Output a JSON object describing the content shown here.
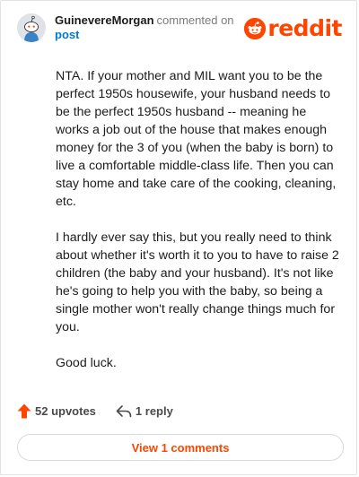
{
  "header": {
    "username": "GuinevereMorgan",
    "action_text": "commented on",
    "post_link": "post"
  },
  "brand": {
    "logo_text": "reddit",
    "logo_icon": "reddit-alien-icon",
    "accent_color": "#ff4500"
  },
  "comment": {
    "paragraphs": [
      "NTA. If your mother and MIL want you to be the perfect 1950s housewife, your husband needs to be the perfect 1950s husband -- meaning he works a job out of the house that makes enough money for the 3 of you (when the baby is born) to live a comfortable middle-class life. Then you can stay home and take care of the cooking, cleaning, etc.",
      "I hardly ever say this, but you really need to think about whether it's worth it to you to have to raise 2 children (the baby and your husband). It's not like he's going to help you with the baby, so being a single mother won't really change things much for you.",
      "Good luck."
    ]
  },
  "actions": {
    "upvotes_label": "52 upvotes",
    "upvote_icon": "upvote-arrow-icon",
    "reply_label": "1 reply",
    "reply_icon": "reply-arrow-icon"
  },
  "footer": {
    "view_comments_label": "View 1 comments"
  }
}
